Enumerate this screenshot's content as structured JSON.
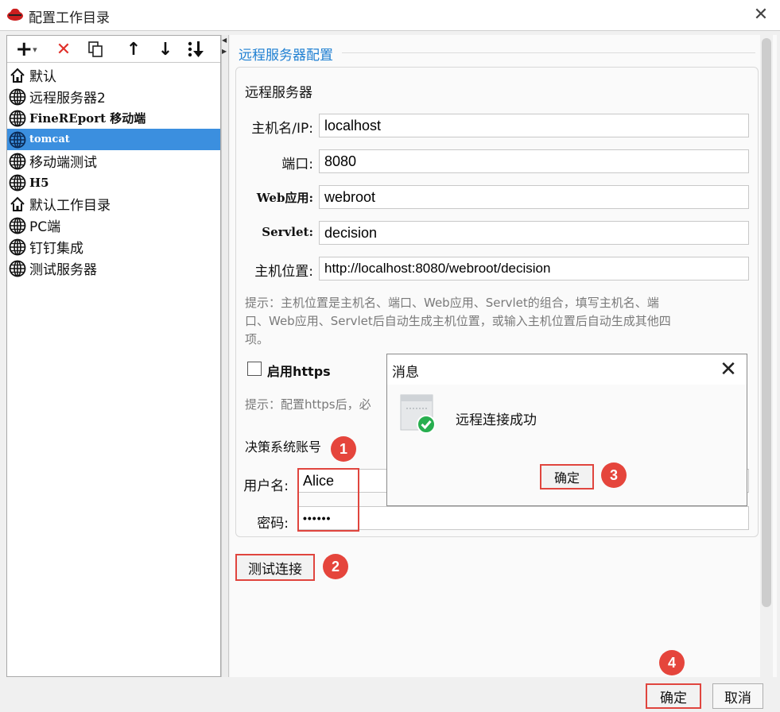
{
  "window": {
    "title": "配置工作目录",
    "close_glyph": "✕"
  },
  "toolbar": {
    "add_label": "+",
    "add_dropdown": "▾",
    "delete_label": "✕",
    "up_label": "↑",
    "down_label": "↓"
  },
  "tree": {
    "items": [
      {
        "label": "默认",
        "icon": "home-icon"
      },
      {
        "label": "远程服务器2",
        "icon": "globe-icon"
      },
      {
        "label": "FineREport 移动端",
        "icon": "globe-icon"
      },
      {
        "label": "tomcat",
        "icon": "globe-icon",
        "selected": true
      },
      {
        "label": "移动端测试",
        "icon": "globe-icon"
      },
      {
        "label": "H5",
        "icon": "globe-icon"
      },
      {
        "label": "默认工作目录",
        "icon": "home-icon"
      },
      {
        "label": "PC端",
        "icon": "globe-icon"
      },
      {
        "label": "钉钉集成",
        "icon": "globe-icon"
      },
      {
        "label": "测试服务器",
        "icon": "globe-icon"
      }
    ]
  },
  "form": {
    "section_title": "远程服务器配置",
    "group_title": "远程服务器",
    "host_label": "主机名/IP:",
    "host_value": "localhost",
    "port_label": "端口:",
    "port_value": "8080",
    "webapp_label": "Web应用:",
    "webapp_value": "webroot",
    "servlet_label": "Servlet:",
    "servlet_value": "decision",
    "location_label": "主机位置:",
    "location_value": "http://localhost:8080/webroot/decision",
    "hint_line1": "提示：主机位置是主机名、端口、Web应用、Servlet的组合，填写主机名、端",
    "hint_line2": "口、Web应用、Servlet后自动生成主机位置，或输入主机位置后自动生成其他四",
    "hint_line3": "项。",
    "https_label": "启用https",
    "https_hint": "提示：配置https后，必",
    "account_title": "决策系统账号",
    "username_label": "用户名:",
    "username_value": "Alice",
    "password_label": "密码:",
    "password_value": "••••••",
    "test_button": "测试连接"
  },
  "message_dialog": {
    "title": "消息",
    "text": "远程连接成功",
    "ok_button": "确定"
  },
  "footer": {
    "ok_button": "确定",
    "cancel_button": "取消"
  },
  "badges": [
    "1",
    "2",
    "3",
    "4"
  ],
  "colors": {
    "accent": "#1e7fd2",
    "selection": "#3b8fdf",
    "highlight_red": "#e0453e"
  }
}
